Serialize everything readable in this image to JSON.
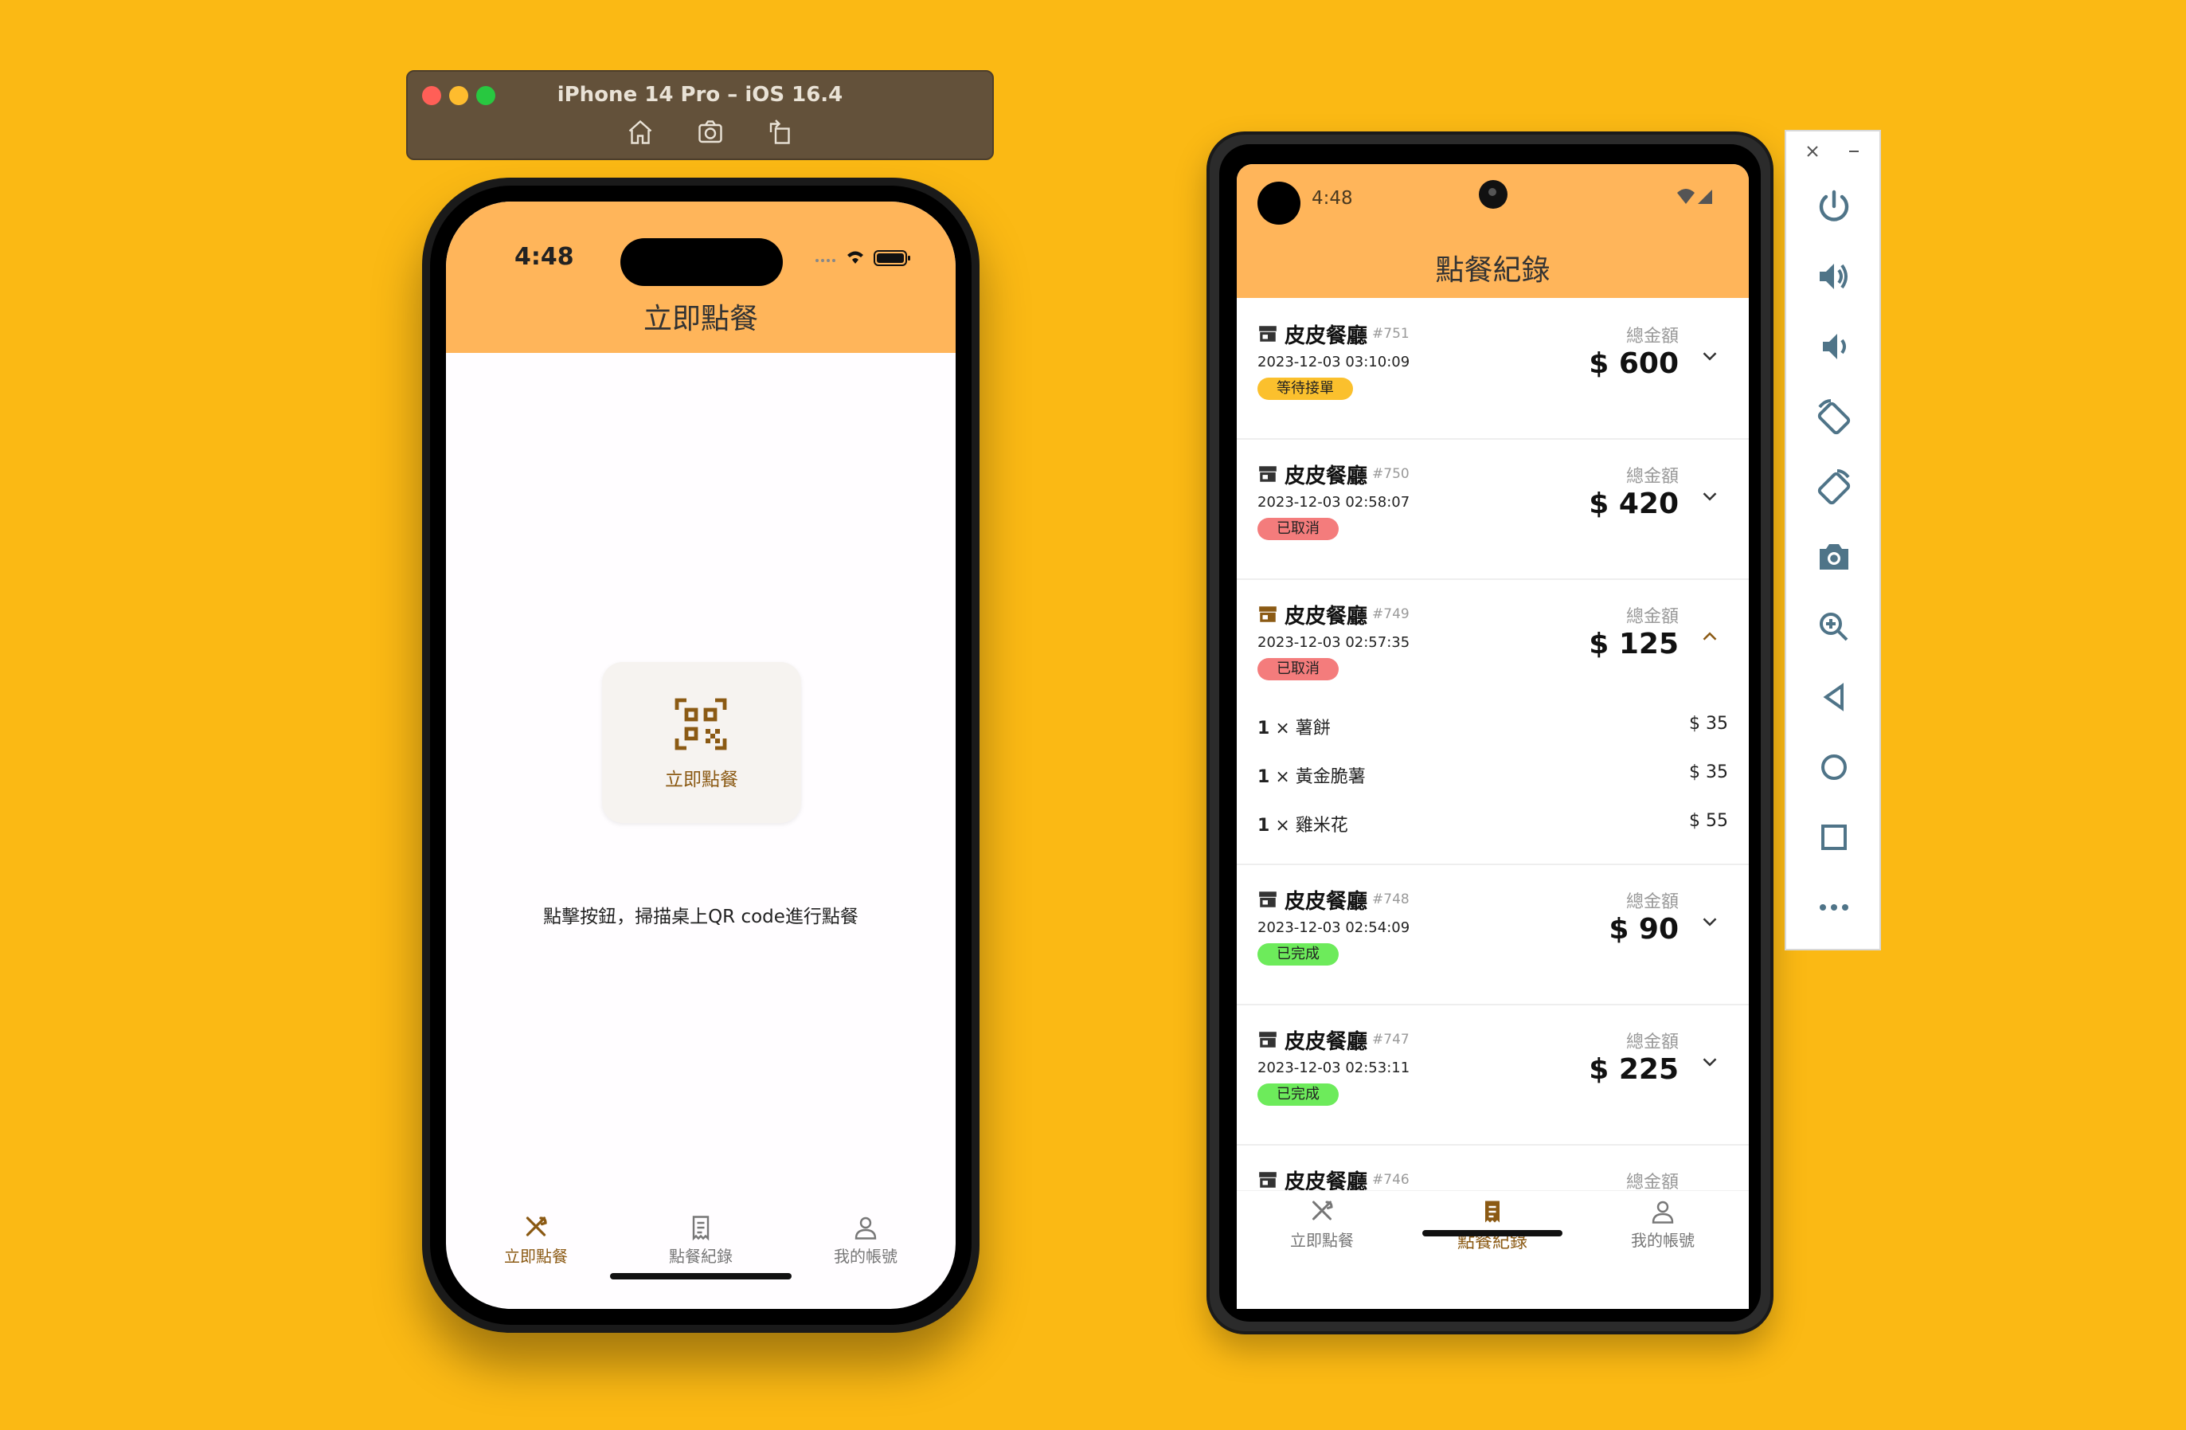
{
  "ios_sim": {
    "window_title": "iPhone 14 Pro – iOS 16.4",
    "toolbar_icons": [
      "home-icon",
      "screenshot-icon",
      "rotate-icon"
    ],
    "status_time": "4:48",
    "page_title": "立即點餐",
    "scan_button_label": "立即點餐",
    "hint_text": "點擊按鈕，掃描桌上QR code進行點餐",
    "nav": [
      {
        "label": "立即點餐",
        "icon": "utensils-icon",
        "active": true
      },
      {
        "label": "點餐紀錄",
        "icon": "receipt-icon",
        "active": false
      },
      {
        "label": "我的帳號",
        "icon": "person-icon",
        "active": false
      }
    ]
  },
  "android_emu": {
    "status_time": "4:48",
    "page_title": "點餐紀錄",
    "total_label": "總金額",
    "orders": [
      {
        "store": "皮皮餐廳",
        "number": "#751",
        "datetime": "2023-12-03 03:10:09",
        "status": "等待接單",
        "status_color": "#FBC02D",
        "amount": "$ 600",
        "expanded": false
      },
      {
        "store": "皮皮餐廳",
        "number": "#750",
        "datetime": "2023-12-03 02:58:07",
        "status": "已取消",
        "status_color": "#F47C7C",
        "amount": "$ 420",
        "expanded": false
      },
      {
        "store": "皮皮餐廳",
        "number": "#749",
        "datetime": "2023-12-03 02:57:35",
        "status": "已取消",
        "status_color": "#F47C7C",
        "amount": "$ 125",
        "expanded": true,
        "items": [
          {
            "qty": "1",
            "name": "× 薯餅",
            "price": "$ 35"
          },
          {
            "qty": "1",
            "name": "× 黃金脆薯",
            "price": "$ 35"
          },
          {
            "qty": "1",
            "name": "× 雞米花",
            "price": "$ 55"
          }
        ]
      },
      {
        "store": "皮皮餐廳",
        "number": "#748",
        "datetime": "2023-12-03 02:54:09",
        "status": "已完成",
        "status_color": "#6DEB5B",
        "amount": "$ 90",
        "expanded": false
      },
      {
        "store": "皮皮餐廳",
        "number": "#747",
        "datetime": "2023-12-03 02:53:11",
        "status": "已完成",
        "status_color": "#6DEB5B",
        "amount": "$ 225",
        "expanded": false
      },
      {
        "store": "皮皮餐廳",
        "number": "#746",
        "datetime": "",
        "status": "",
        "status_color": "",
        "amount": "",
        "expanded": false
      }
    ],
    "nav": [
      {
        "label": "立即點餐",
        "icon": "utensils-icon",
        "active": false
      },
      {
        "label": "點餐紀錄",
        "icon": "receipt-icon",
        "active": true
      },
      {
        "label": "我的帳號",
        "icon": "person-icon",
        "active": false
      }
    ]
  },
  "emulator_toolbar": {
    "window_controls": [
      "close-icon",
      "minimize-icon"
    ],
    "buttons": [
      "power-icon",
      "volume-up-icon",
      "volume-down-icon",
      "rotate-left-icon",
      "rotate-right-icon",
      "camera-icon",
      "zoom-icon",
      "back-icon",
      "home-icon",
      "overview-icon",
      "more-icon"
    ]
  },
  "colors": {
    "background": "#FBB914",
    "header": "#FFB55A",
    "accent_brown": "#8B5A14",
    "nav_inactive": "#777777"
  }
}
